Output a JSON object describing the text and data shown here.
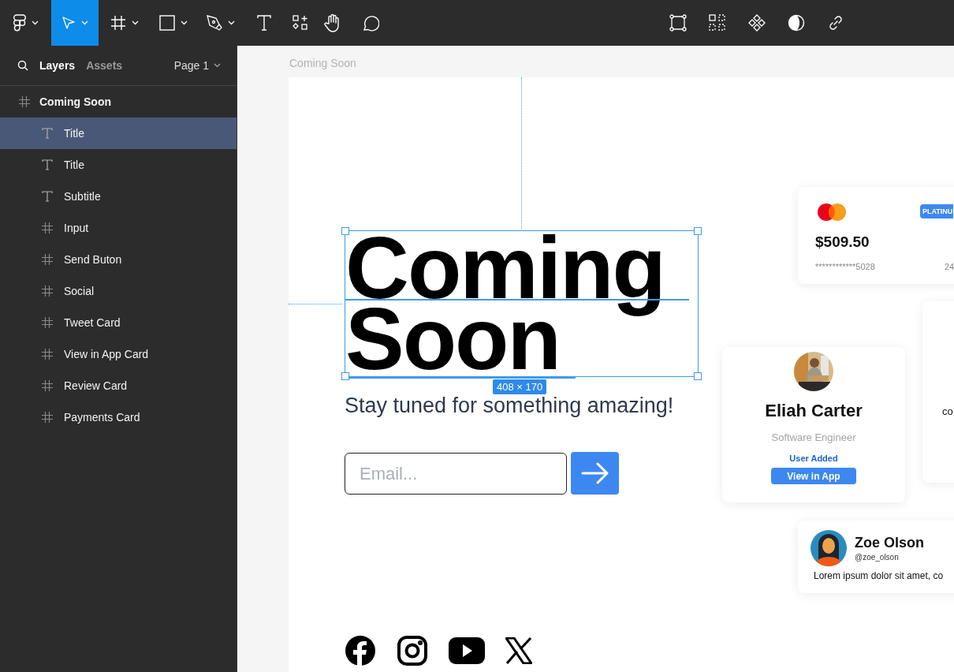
{
  "toolbar": {
    "tools": [
      {
        "kind": "logo",
        "dropdown": true,
        "selected": false
      },
      {
        "kind": "move",
        "dropdown": true,
        "selected": true
      },
      {
        "kind": "frame",
        "dropdown": true,
        "selected": false
      },
      {
        "kind": "rectangle",
        "dropdown": true,
        "selected": false
      },
      {
        "kind": "pen",
        "dropdown": true,
        "selected": false
      },
      {
        "kind": "text",
        "dropdown": false,
        "selected": false
      },
      {
        "kind": "resources",
        "dropdown": false,
        "selected": false
      },
      {
        "kind": "hand",
        "dropdown": false,
        "selected": false
      },
      {
        "kind": "comment",
        "dropdown": false,
        "selected": false
      }
    ],
    "actions": [
      {
        "kind": "frame-selection"
      },
      {
        "kind": "grid"
      },
      {
        "kind": "component"
      },
      {
        "kind": "contrast"
      },
      {
        "kind": "link"
      }
    ]
  },
  "sidebar": {
    "tabs": [
      {
        "label": "Layers",
        "selected": true
      },
      {
        "label": "Assets",
        "selected": false
      }
    ],
    "page": "Page 1",
    "layers": [
      {
        "name": "Coming Soon",
        "kind": "frame",
        "selected": false,
        "children": [
          {
            "name": "Title",
            "kind": "text",
            "selected": true
          },
          {
            "name": "Title",
            "kind": "text",
            "selected": false
          },
          {
            "name": "Subtitle",
            "kind": "text",
            "selected": false
          },
          {
            "name": "Input",
            "kind": "frame",
            "selected": false
          },
          {
            "name": "Send Buton",
            "kind": "frame",
            "selected": false
          },
          {
            "name": "Social",
            "kind": "frame",
            "selected": false
          },
          {
            "name": "Tweet Card",
            "kind": "frame",
            "selected": false
          },
          {
            "name": "View in App Card",
            "kind": "frame",
            "selected": false
          },
          {
            "name": "Review Card",
            "kind": "frame",
            "selected": false
          },
          {
            "name": "Payments Card",
            "kind": "frame",
            "selected": false
          }
        ]
      }
    ]
  },
  "canvas": {
    "frame_label": "Coming Soon",
    "title": "Coming Soon",
    "size_badge": "408 × 170",
    "subtitle": "Stay tuned for something amazing!",
    "email": {
      "placeholder": "Email..."
    },
    "social": [
      {
        "kind": "facebook"
      },
      {
        "kind": "instagram"
      },
      {
        "kind": "youtube"
      },
      {
        "kind": "x"
      }
    ],
    "payment_card": {
      "amount": "$509.50",
      "badge": "PLATINU",
      "card_number": "************5028",
      "column_2": "24"
    },
    "profile_card": {
      "name": "Eliah Carter",
      "role": "Software Engineer",
      "status": "User Added",
      "button": "View in App"
    },
    "review_card": {
      "text": "co"
    },
    "tweet_card": {
      "name": "Zoe Olson",
      "handle": "@zoe_olson",
      "text": "Lorem ipsum dolor sit amet, co"
    }
  }
}
